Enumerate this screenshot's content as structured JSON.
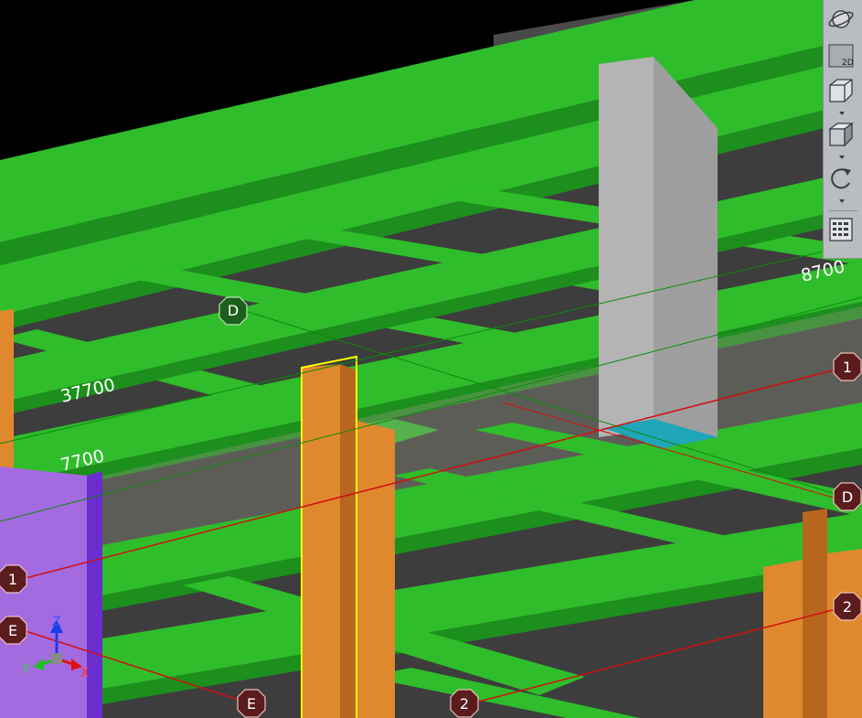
{
  "toolbar": {
    "buttons": [
      {
        "name": "orbit-view",
        "icon": "globe-orbit-icon"
      },
      {
        "name": "2d-view",
        "icon": "2d-plane-icon",
        "label": "2D"
      },
      {
        "name": "view-cube",
        "icon": "wireframe-cube-icon",
        "has_dropdown": true
      },
      {
        "name": "shaded-cube",
        "icon": "shaded-cube-icon",
        "has_dropdown": true
      },
      {
        "name": "rotate",
        "icon": "rotate-arrow-icon",
        "has_dropdown": true
      },
      {
        "name": "display-settings",
        "icon": "checklist-icon"
      }
    ]
  },
  "dimensions": {
    "dim_1": "37700",
    "dim_2": "7700",
    "dim_3": "8700"
  },
  "grid_labels": {
    "d_top": "D",
    "d_right": "D",
    "one_left": "1",
    "one_right": "1",
    "two_bottom": "2",
    "two_right": "2",
    "e_left": "E",
    "e_bottom": "E"
  },
  "axes": {
    "z": "Z",
    "y": "Y",
    "x": "X"
  },
  "colors": {
    "beam": "#2fbd2b",
    "beam_side": "#1c8f1d",
    "slab_dark": "#3a3a3a",
    "column_orange": "#e0882e",
    "column_orange_side": "#b8661d",
    "column_purple": "#a46ae0",
    "column_grey": "#b4b4b4",
    "selection": "#ffff00",
    "gridline_red": "#d01010",
    "gridline_green": "#0a8a0a"
  }
}
